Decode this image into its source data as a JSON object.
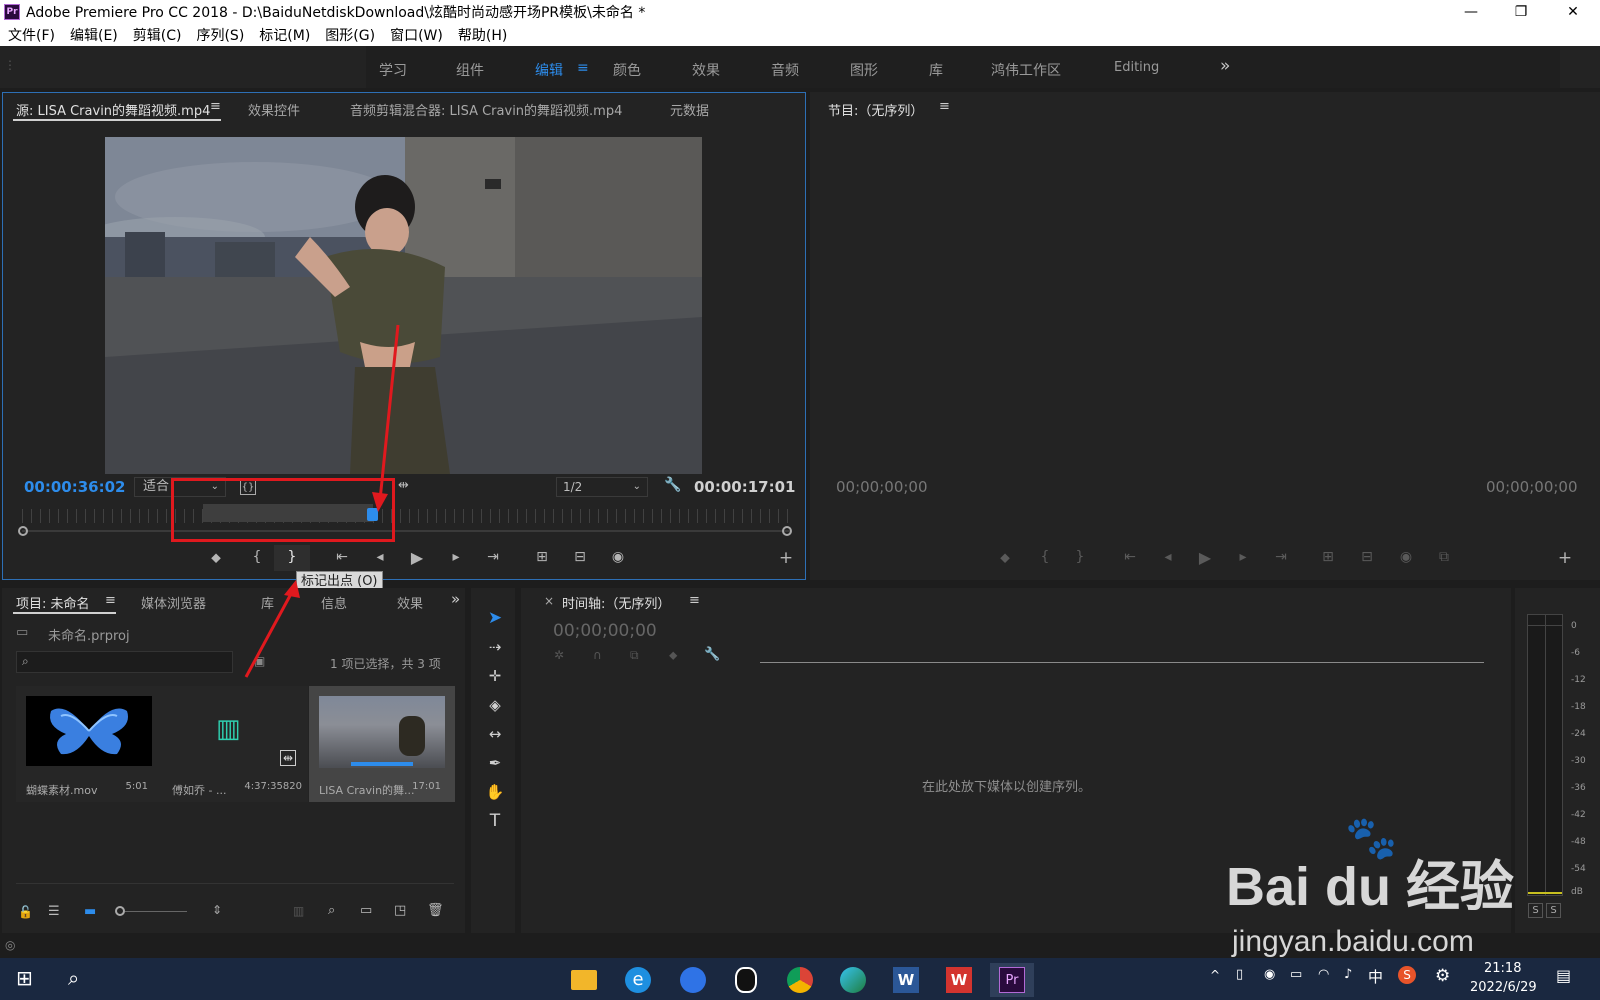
{
  "titlebar": {
    "icon_text": "Pr",
    "title": "Adobe Premiere Pro CC 2018 - D:\\BaiduNetdiskDownload\\炫酷时尚动感开场PR模板\\未命名 *",
    "minimize": "—",
    "maximize": "❐",
    "close": "✕"
  },
  "menu": [
    "文件(F)",
    "编辑(E)",
    "剪辑(C)",
    "序列(S)",
    "标记(M)",
    "图形(G)",
    "窗口(W)",
    "帮助(H)"
  ],
  "workspaces": {
    "items": [
      "学习",
      "组件",
      "编辑",
      "颜色",
      "效果",
      "音频",
      "图形",
      "库",
      "鸿伟工作区",
      "Editing"
    ],
    "active": "编辑",
    "more": "»"
  },
  "source_panel": {
    "tabs": [
      "源: LISA Cravin的舞蹈视频.mp4",
      "效果控件",
      "音频剪辑混合器: LISA Cravin的舞蹈视频.mp4",
      "元数据"
    ],
    "timecode_current": "00:00:36:02",
    "zoom": "适合",
    "resolution": "1/2",
    "timecode_duration": "00:00:17:01",
    "tooltip": "标记出点 (O)"
  },
  "program_panel": {
    "tab": "节目:（无序列）",
    "timecode_left": "00;00;00;00",
    "timecode_right": "00;00;00;00"
  },
  "project_panel": {
    "tabs": [
      "项目: 未命名",
      "媒体浏览器",
      "库",
      "信息",
      "效果"
    ],
    "project_file": "未命名.prproj",
    "search_placeholder": "",
    "selection_info": "1 项已选择，共 3 项",
    "items": [
      {
        "name": "蝴蝶素材.mov",
        "duration": "5:01"
      },
      {
        "name": "傅如乔 - ...",
        "duration": "4:37:35820"
      },
      {
        "name": "LISA Cravin的舞...",
        "duration": "17:01"
      }
    ]
  },
  "timeline_panel": {
    "tab": "时间轴:（无序列）",
    "timecode": "00;00;00;00",
    "empty_message": "在此处放下媒体以创建序列。"
  },
  "audio_meter": {
    "labels": [
      "0",
      "-6",
      "-12",
      "-18",
      "-24",
      "-30",
      "-36",
      "-42",
      "-48",
      "-54",
      "dB"
    ],
    "solo": [
      "S",
      "S"
    ]
  },
  "watermark": {
    "brand": "Bai du 经验",
    "url": "jingyan.baidu.com"
  },
  "taskbar": {
    "time": "21:18",
    "date": "2022/6/29",
    "ime": "中"
  },
  "colors": {
    "accent_blue": "#2d8ceb",
    "annotation_red": "#e0191e",
    "panel_bg": "#232323",
    "window_bg": "#1d1d1d"
  }
}
